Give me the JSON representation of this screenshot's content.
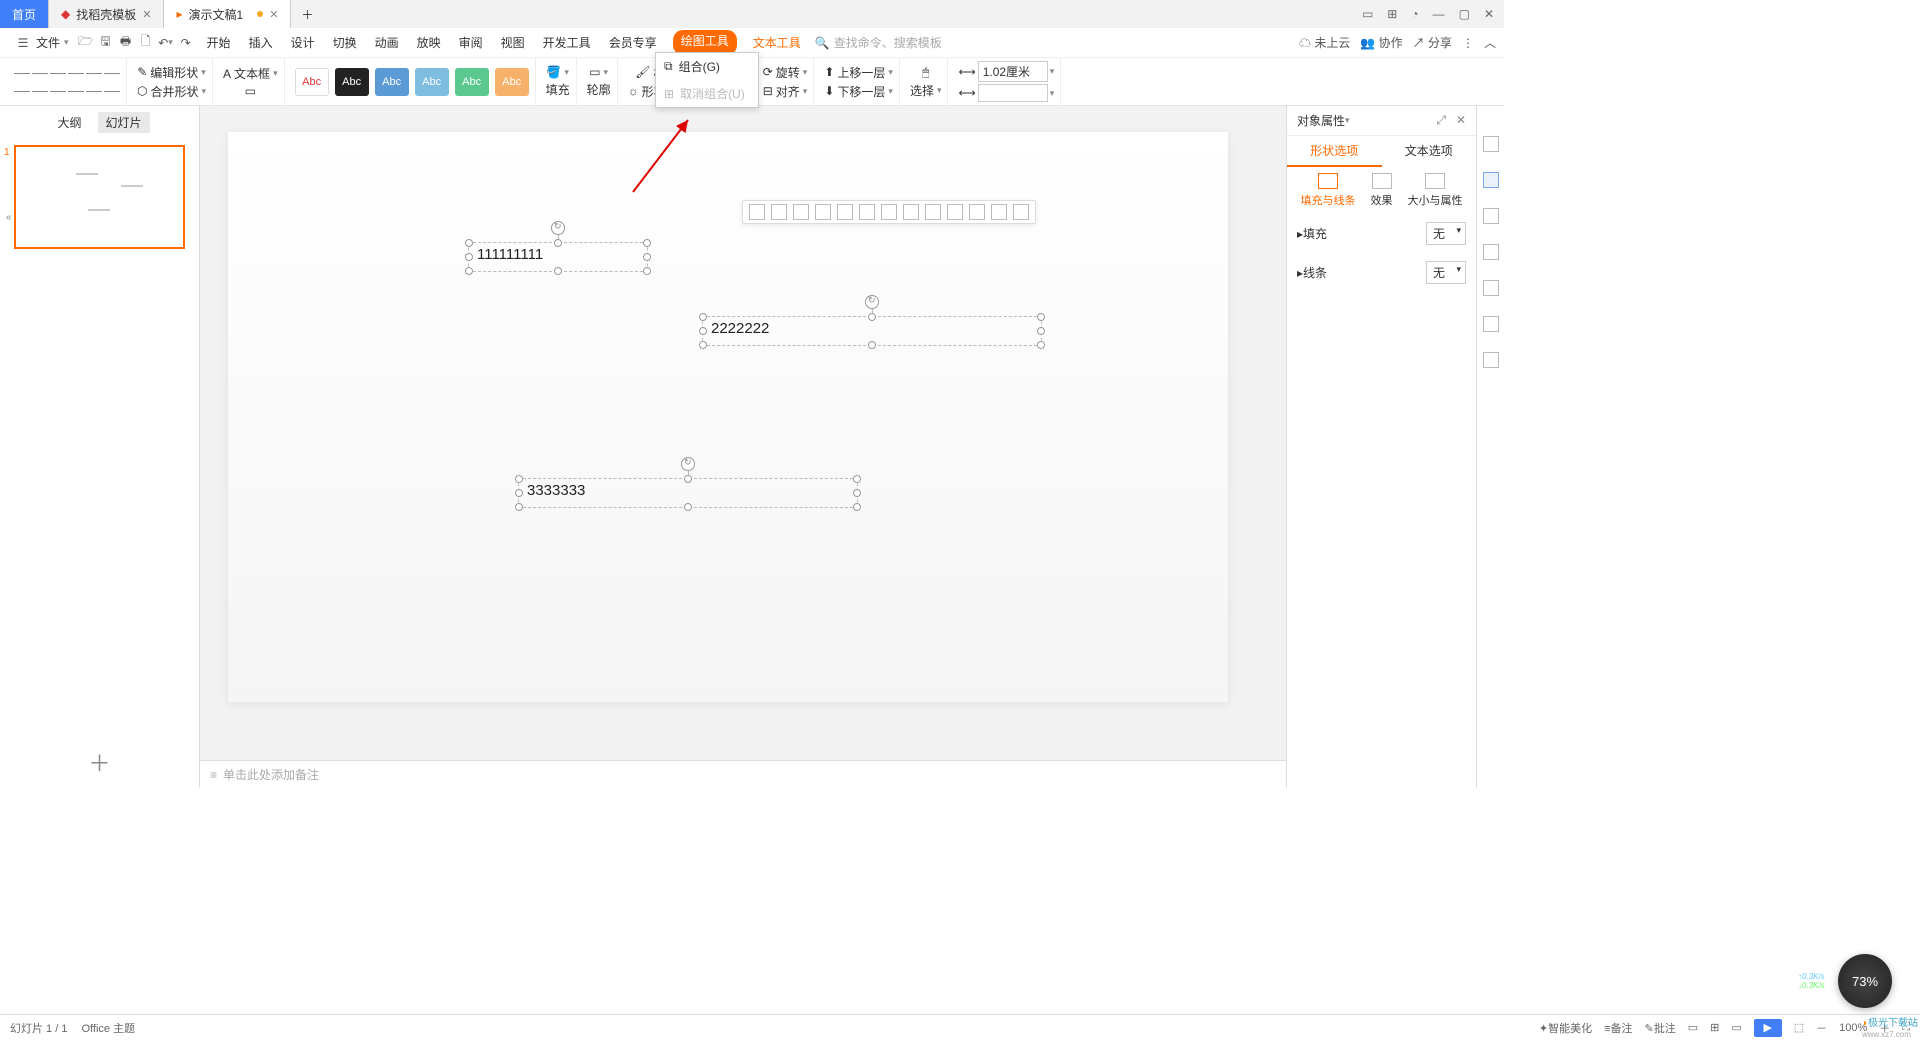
{
  "tabs": {
    "home": "首页",
    "t1": "找稻壳模板",
    "t2": "演示文稿1"
  },
  "menu": {
    "file": "文件",
    "items": [
      "开始",
      "插入",
      "设计",
      "切换",
      "动画",
      "放映",
      "审阅",
      "视图",
      "开发工具",
      "会员专享"
    ],
    "hl1": "绘图工具",
    "hl2": "文本工具",
    "search_ph": "查找命令、搜索模板",
    "cloud": "未上云",
    "collab": "协作",
    "share": "分享"
  },
  "ribbon": {
    "edit_shape": "编辑形状",
    "merge_shape": "合并形状",
    "text_box": "文本框",
    "abc": "Abc",
    "fill": "填充",
    "outline": "轮廓",
    "shape_fx": "形状效果",
    "format_brush": "格式刷",
    "group": "组合",
    "rotate": "旋转",
    "align": "对齐",
    "up": "上移一层",
    "down": "下移一层",
    "select": "选择",
    "dim": "1.02厘米"
  },
  "dropdown": {
    "group": "组合(G)",
    "ungroup": "取消组合(U)"
  },
  "left": {
    "outline": "大纲",
    "slides": "幻灯片",
    "add": "＋"
  },
  "canvas": {
    "notes_ph": "单击此处添加备注",
    "t1": "111111111",
    "t2": "2222222",
    "t3": "3333333"
  },
  "right": {
    "title": "对象属性",
    "tab1": "形状选项",
    "tab2": "文本选项",
    "s1": "填充与线条",
    "s2": "效果",
    "s3": "大小与属性",
    "fill": "填充",
    "line": "线条",
    "none": "无"
  },
  "status": {
    "page": "幻灯片 1 / 1",
    "theme": "Office 主题",
    "smart": "智能美化",
    "notes": "备注",
    "comment": "批注",
    "zoom": "100%"
  },
  "badge": {
    "pct": "73%",
    "up": "0.3K/s",
    "dn": "0.3K/s"
  },
  "logo": "极光下载站"
}
